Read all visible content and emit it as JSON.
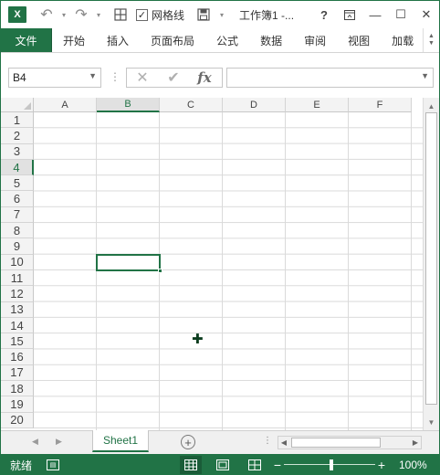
{
  "titlebar": {
    "logo": "X",
    "gridlines_label": "网格线",
    "gridlines_checked": "✓",
    "doc_title": "工作簿1 -...",
    "help": "?",
    "minimize": "—",
    "restore": "☐",
    "close": "✕"
  },
  "ribbon": {
    "file_tab": "文件",
    "tabs": [
      "开始",
      "插入",
      "页面布局",
      "公式",
      "数据",
      "审阅",
      "视图",
      "加载"
    ]
  },
  "formula_bar": {
    "name_box_value": "B4",
    "cancel_glyph": "✕",
    "enter_glyph": "✔",
    "fx_label": "fx",
    "formula_value": ""
  },
  "sheet": {
    "columns": [
      "A",
      "B",
      "C",
      "D",
      "E",
      "F"
    ],
    "rows": [
      "1",
      "2",
      "3",
      "4",
      "5",
      "6",
      "7",
      "8",
      "9",
      "10",
      "11",
      "12",
      "13",
      "14",
      "15",
      "16",
      "17",
      "18",
      "19",
      "20"
    ],
    "selected_column": "B",
    "selected_row": "4"
  },
  "sheet_tabs": {
    "active_tab": "Sheet1",
    "add_glyph": "+",
    "more_glyph": "⋮"
  },
  "status_bar": {
    "ready_text": "就绪",
    "zoom_minus": "−",
    "zoom_plus": "+",
    "zoom_level": "100%"
  },
  "colors": {
    "accent": "#217346",
    "gridline": "#dadada",
    "header_bg": "#f3f3f3"
  },
  "icons": [
    "excel-logo-icon",
    "undo-icon",
    "redo-icon",
    "table-icon",
    "save-icon",
    "cell-cursor-icon",
    "macro-record-icon",
    "normal-view-icon",
    "page-layout-icon",
    "page-break-icon"
  ]
}
